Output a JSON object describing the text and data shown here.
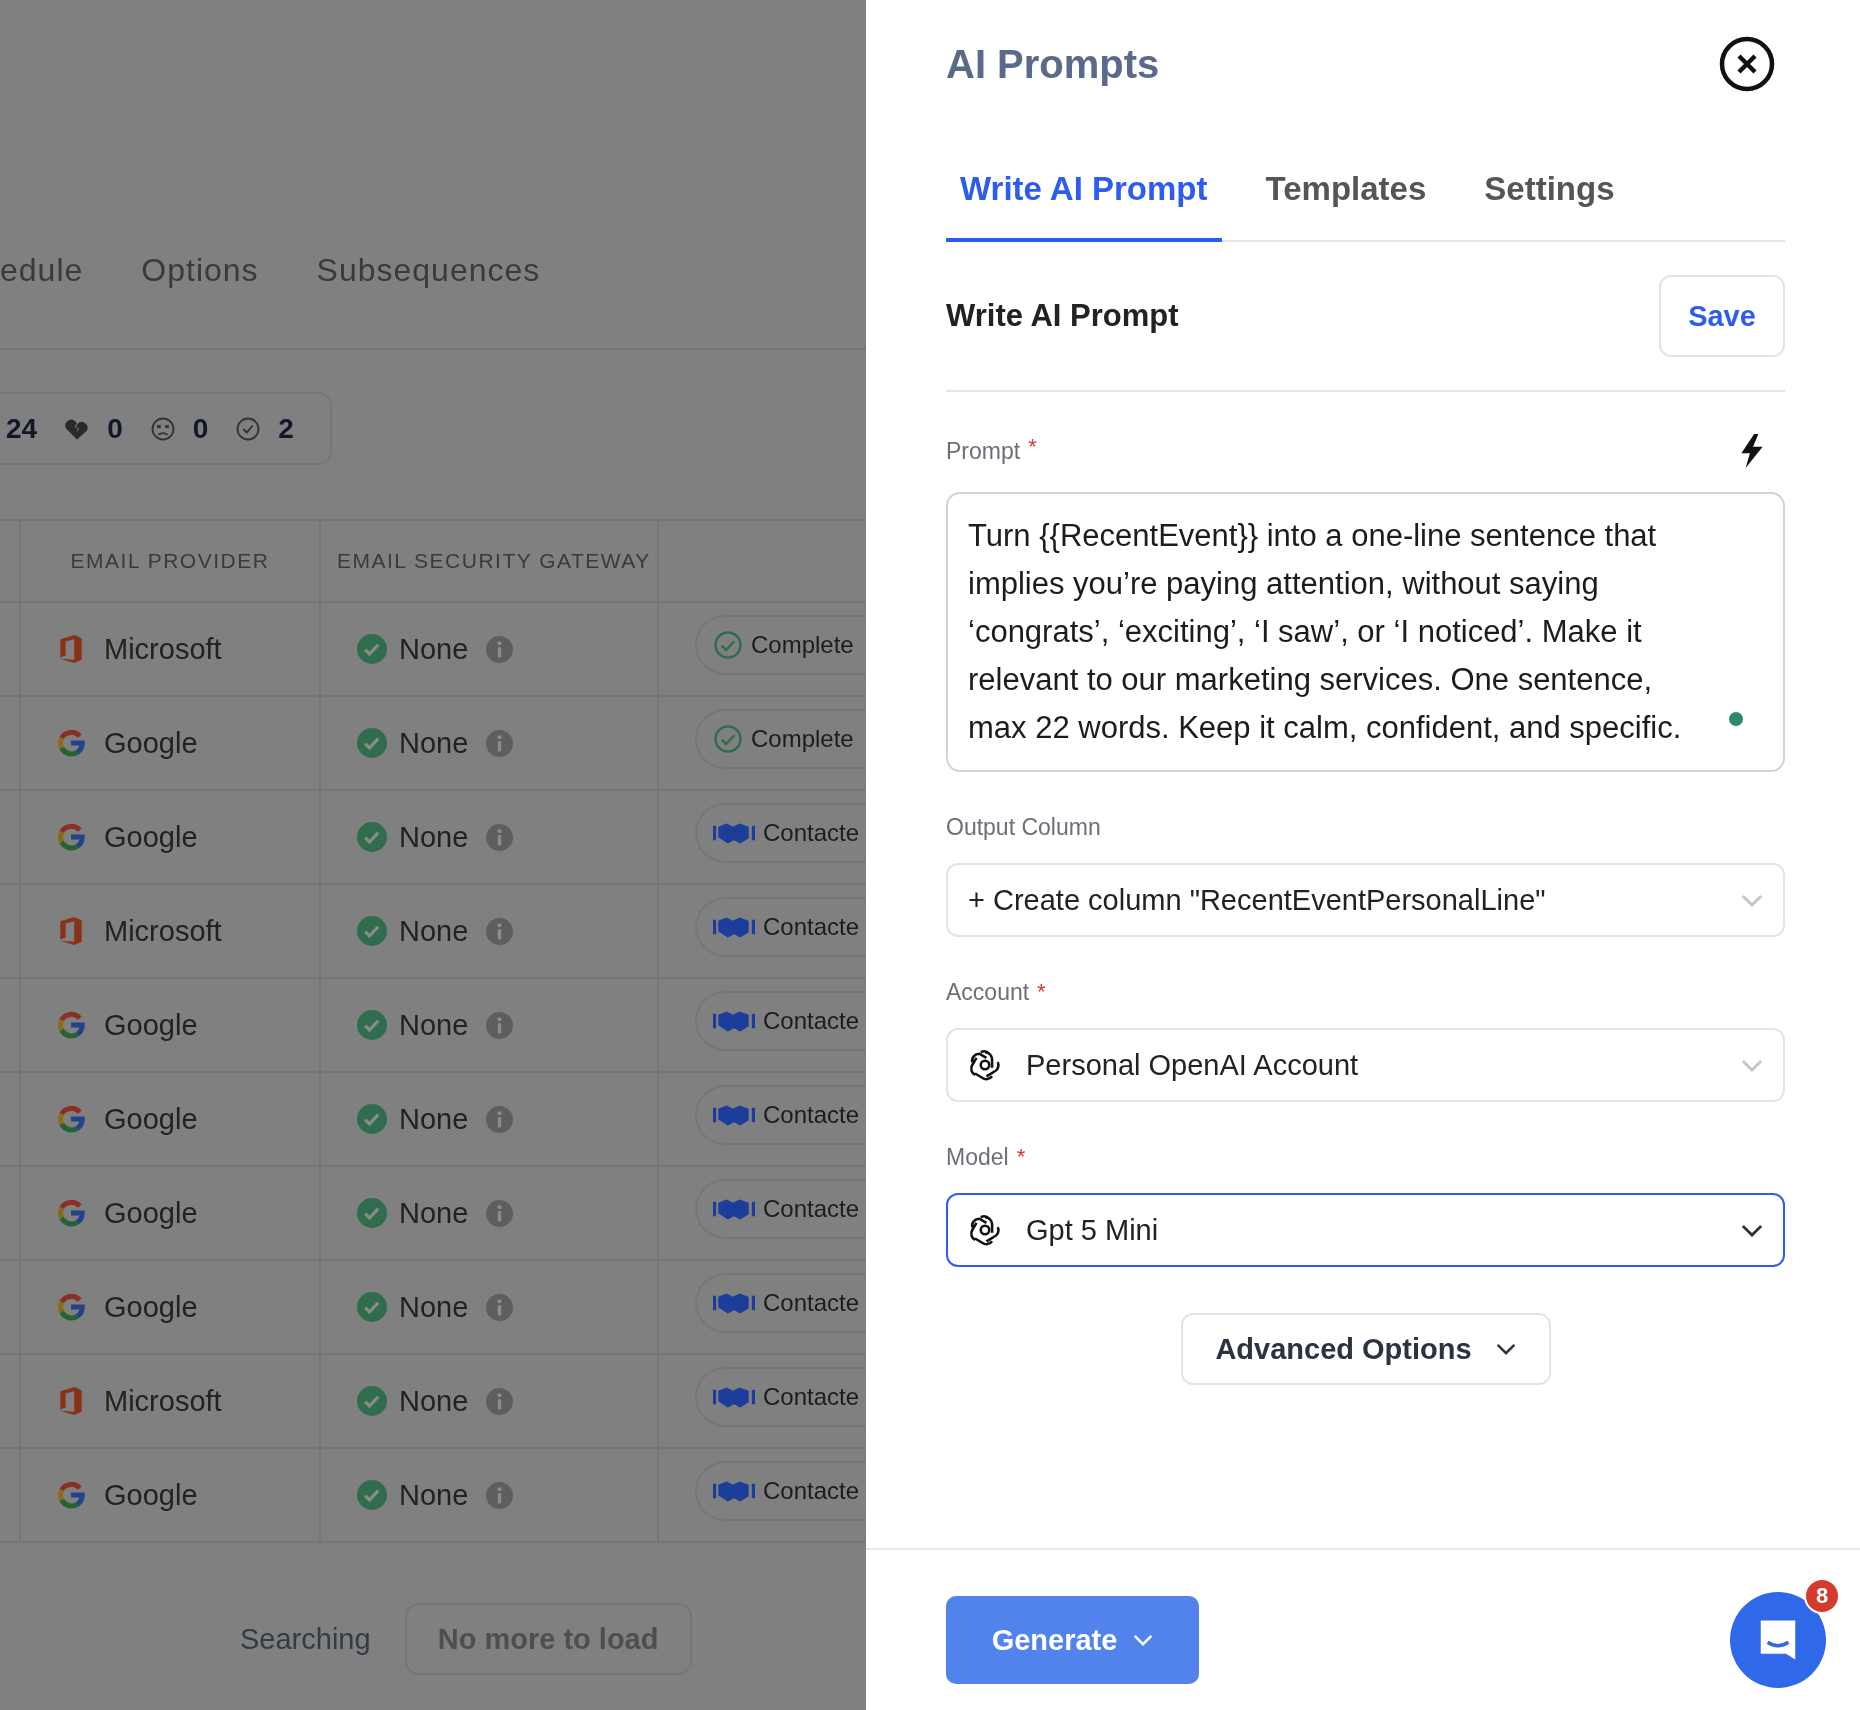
{
  "background": {
    "tabs": [
      {
        "label": "edule"
      },
      {
        "label": "Options"
      },
      {
        "label": "Subsequences"
      }
    ],
    "stats": [
      {
        "kind": "total",
        "value": "24"
      },
      {
        "kind": "broken-heart",
        "value": "0"
      },
      {
        "kind": "dizzy",
        "value": "0"
      },
      {
        "kind": "done",
        "value": "2"
      }
    ],
    "table": {
      "columns": [
        "EMAIL PROVIDER",
        "EMAIL SECURITY GATEWAY"
      ],
      "rows": [
        {
          "provider": {
            "kind": "microsoft",
            "label": "Microsoft"
          },
          "gateway": "None",
          "status": {
            "kind": "completed",
            "label": "Complete"
          }
        },
        {
          "provider": {
            "kind": "google",
            "label": "Google"
          },
          "gateway": "None",
          "status": {
            "kind": "completed",
            "label": "Complete"
          }
        },
        {
          "provider": {
            "kind": "google",
            "label": "Google"
          },
          "gateway": "None",
          "status": {
            "kind": "contacted",
            "label": "Contacte"
          }
        },
        {
          "provider": {
            "kind": "microsoft",
            "label": "Microsoft"
          },
          "gateway": "None",
          "status": {
            "kind": "contacted",
            "label": "Contacte"
          }
        },
        {
          "provider": {
            "kind": "google",
            "label": "Google"
          },
          "gateway": "None",
          "status": {
            "kind": "contacted",
            "label": "Contacte"
          }
        },
        {
          "provider": {
            "kind": "google",
            "label": "Google"
          },
          "gateway": "None",
          "status": {
            "kind": "contacted",
            "label": "Contacte"
          }
        },
        {
          "provider": {
            "kind": "google",
            "label": "Google"
          },
          "gateway": "None",
          "status": {
            "kind": "contacted",
            "label": "Contacte"
          }
        },
        {
          "provider": {
            "kind": "google",
            "label": "Google"
          },
          "gateway": "None",
          "status": {
            "kind": "contacted",
            "label": "Contacte"
          }
        },
        {
          "provider": {
            "kind": "microsoft",
            "label": "Microsoft"
          },
          "gateway": "None",
          "status": {
            "kind": "contacted",
            "label": "Contacte"
          }
        },
        {
          "provider": {
            "kind": "google",
            "label": "Google"
          },
          "gateway": "None",
          "status": {
            "kind": "contacted",
            "label": "Contacte"
          }
        }
      ]
    },
    "footer": {
      "status": "Searching",
      "button": "No more to load"
    }
  },
  "panel": {
    "title": "AI Prompts",
    "tabs": [
      {
        "label": "Write AI Prompt",
        "selected": true
      },
      {
        "label": "Templates",
        "selected": false
      },
      {
        "label": "Settings",
        "selected": false
      }
    ],
    "section_title": "Write AI Prompt",
    "save_button": "Save",
    "prompt": {
      "label": "Prompt",
      "required_mark": "*",
      "value": "Turn {{RecentEvent}} into a one-line sentence that implies you’re paying attention, without saying ‘congrats’, ‘exciting’, ‘I saw’, or ‘I noticed’. Make it relevant to our marketing services. One sentence, max 22 words. Keep it calm, confident, and specific."
    },
    "selects": [
      {
        "label": "Output Column",
        "value": "+ Create column \"RecentEventPersonalLine\"",
        "icon": false,
        "focused": false
      },
      {
        "label": "Account",
        "required_mark": "*",
        "value": "Personal OpenAI Account",
        "icon": true,
        "focused": false
      },
      {
        "label": "Model",
        "required_mark": "*",
        "value": "Gpt 5 Mini",
        "icon": true,
        "focused": true
      }
    ],
    "advanced_button": "Advanced Options",
    "generate_button": "Generate",
    "chat_badge": "8"
  }
}
